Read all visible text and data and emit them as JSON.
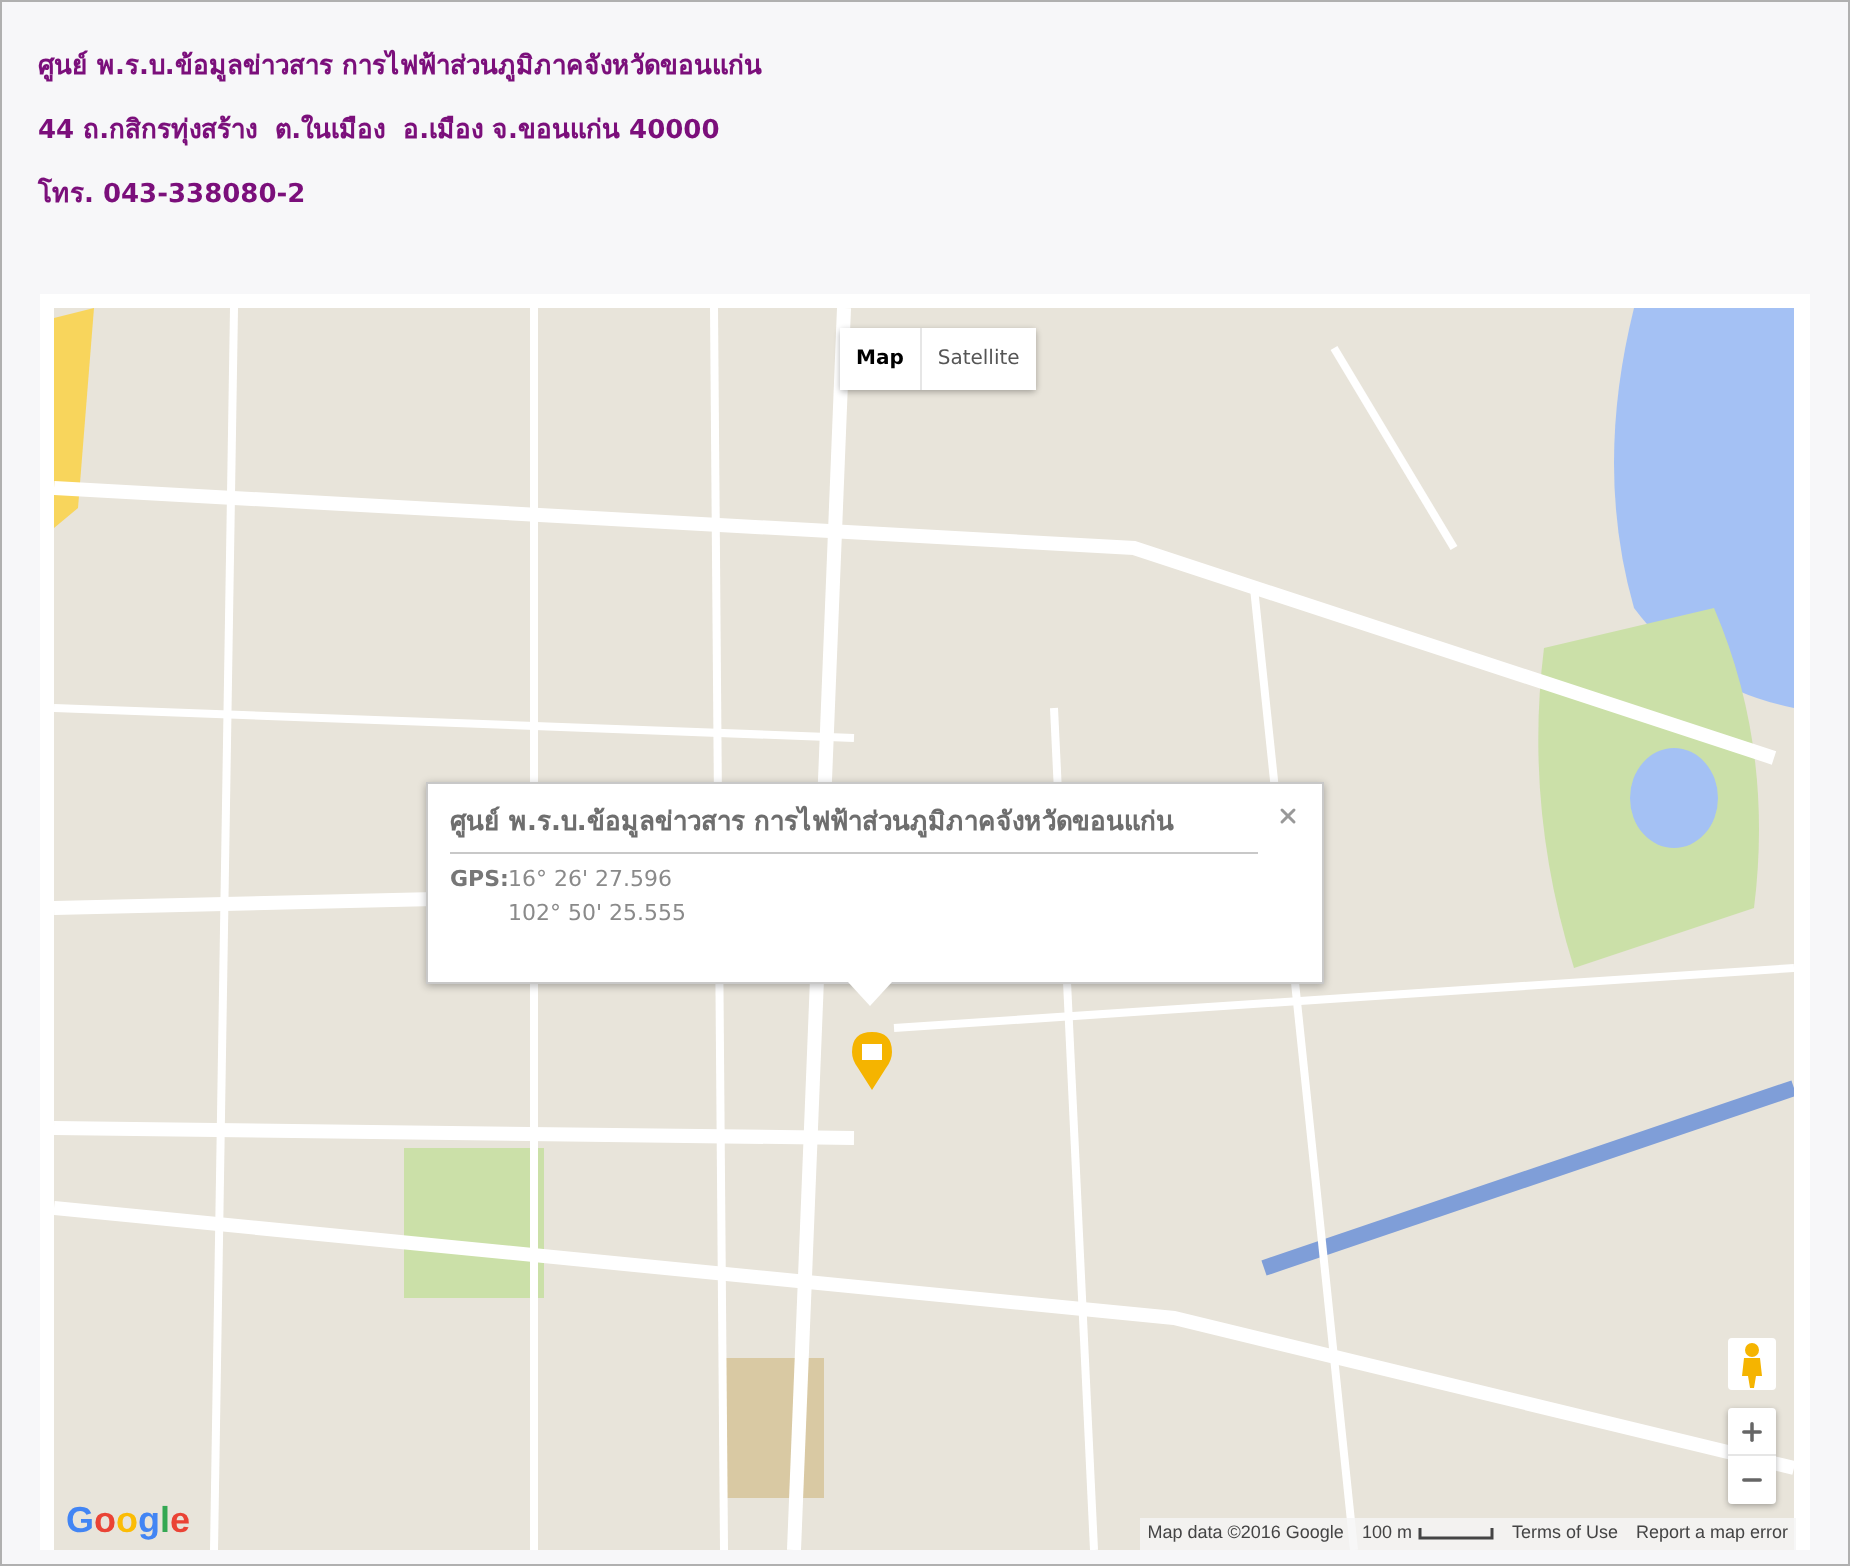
{
  "header": {
    "lines": [
      "ศูนย์ พ.ร.บ.ข้อมูลข่าวสาร การไฟฟ้าส่วนภูมิภาคจังหวัดขอนแก่น",
      "44 ถ.กสิกรทุ่งสร้าง  ต.ในเมือง  อ.เมือง จ.ขอนแก่น 40000",
      "โทร. 043-338080-2"
    ]
  },
  "map": {
    "type_buttons": [
      {
        "label": "Map",
        "selected": true
      },
      {
        "label": "Satellite",
        "selected": false
      }
    ],
    "info_window": {
      "title": "ศูนย์ พ.ร.บ.ข้อมูลข่าวสาร การไฟฟ้าส่วนภูมิภาคจังหวัดขอนแก่น",
      "gps_label": "GPS:",
      "latitude": "16° 26' 27.596",
      "longitude": "102° 50' 25.555"
    },
    "logo": "Google",
    "footer": {
      "attribution": "Map data ©2016 Google",
      "scale": "100 m",
      "terms": "Terms of Use",
      "report": "Report a map error"
    }
  }
}
